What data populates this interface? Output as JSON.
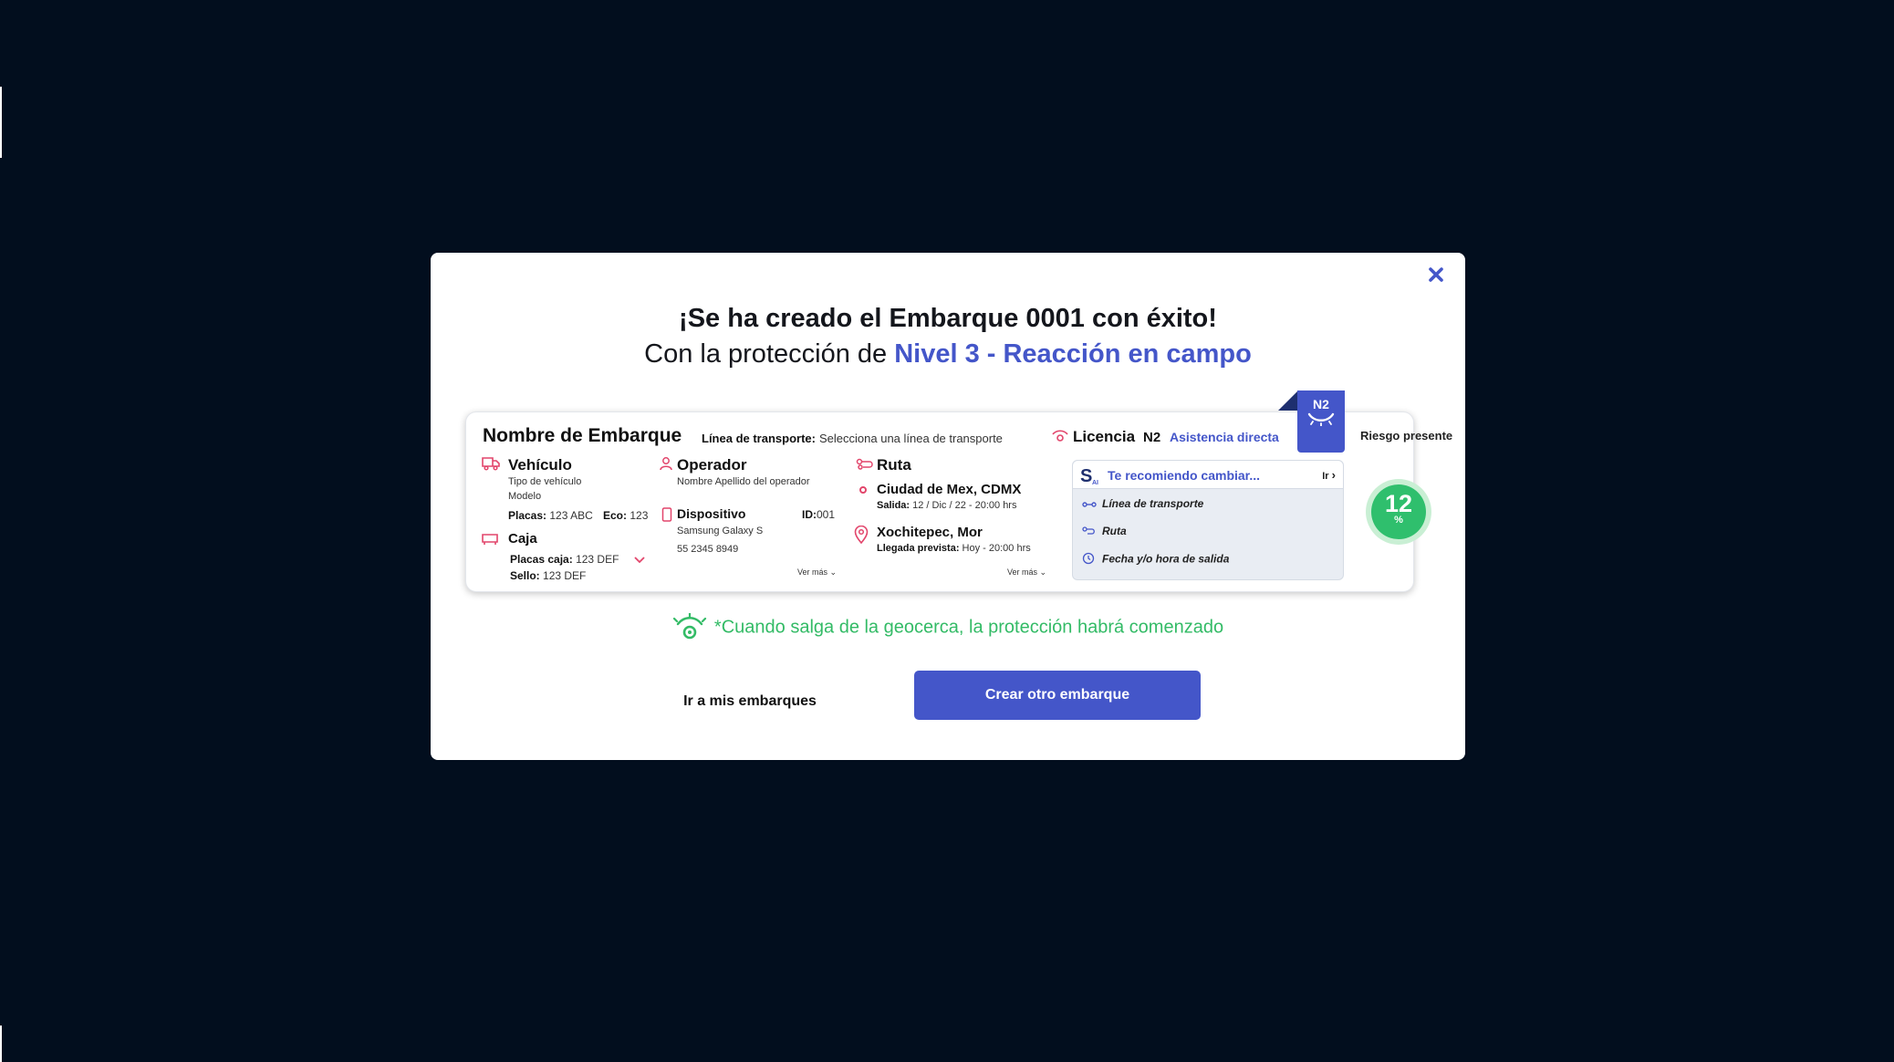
{
  "modal": {
    "title": "¡Se ha creado el Embarque 0001 con éxito!",
    "subtitle_prefix": "Con la protección de ",
    "subtitle_level": "Nivel 3 - Reacción en campo",
    "close_icon": "close-icon"
  },
  "shipment": {
    "name": "Nombre de Embarque",
    "transport_line_label": "Línea de transporte:",
    "transport_line_value": "Selecciona una línea de transporte",
    "vehicle": {
      "title": "Vehículo",
      "type": "Tipo de vehículo",
      "model": "Modelo",
      "plates_label": "Placas:",
      "plates_value": "123 ABC",
      "eco_label": "Eco:",
      "eco_value": "123"
    },
    "box": {
      "title": "Caja",
      "plates_label": "Placas caja:",
      "plates_value": "123 DEF",
      "seal_label": "Sello:",
      "seal_value": "123 DEF"
    },
    "operator": {
      "title": "Operador",
      "name": "Nombre Apellido del operador"
    },
    "device": {
      "title": "Dispositivo",
      "id_label": "ID:",
      "id_value": "001",
      "model": "Samsung Galaxy S",
      "phone": "55 2345 8949",
      "see_more": "Ver más"
    },
    "route": {
      "title": "Ruta",
      "origin": "Ciudad de Mex, CDMX",
      "departure_label": "Salida:",
      "departure_value": "12 / Dic / 22 - 20:00 hrs",
      "destination": "Xochitepec, Mor",
      "arrival_label": "Llegada prevista:",
      "arrival_value": "Hoy - 20:00 hrs",
      "see_more": "Ver más"
    },
    "license": {
      "label": "Licencia",
      "level": "N2",
      "assist": "Asistencia directa",
      "tag": "N2"
    },
    "recommendation": {
      "title": "Te recomiendo cambiar...",
      "go": "Ir",
      "items": [
        "Línea de transporte",
        "Ruta",
        "Fecha y/o hora de salida"
      ]
    },
    "risk": {
      "label": "Riesgo presente",
      "value": "12",
      "unit": "%"
    }
  },
  "geofence_note": "*Cuando salga de la geocerca, la protección habrá comenzado",
  "actions": {
    "secondary": "Ir a mis embarques",
    "primary": "Crear otro embarque"
  },
  "colors": {
    "backdrop": "#020e1e",
    "accent": "#4456c9",
    "success": "#2fbf6d",
    "icon_pink": "#e2456b"
  }
}
